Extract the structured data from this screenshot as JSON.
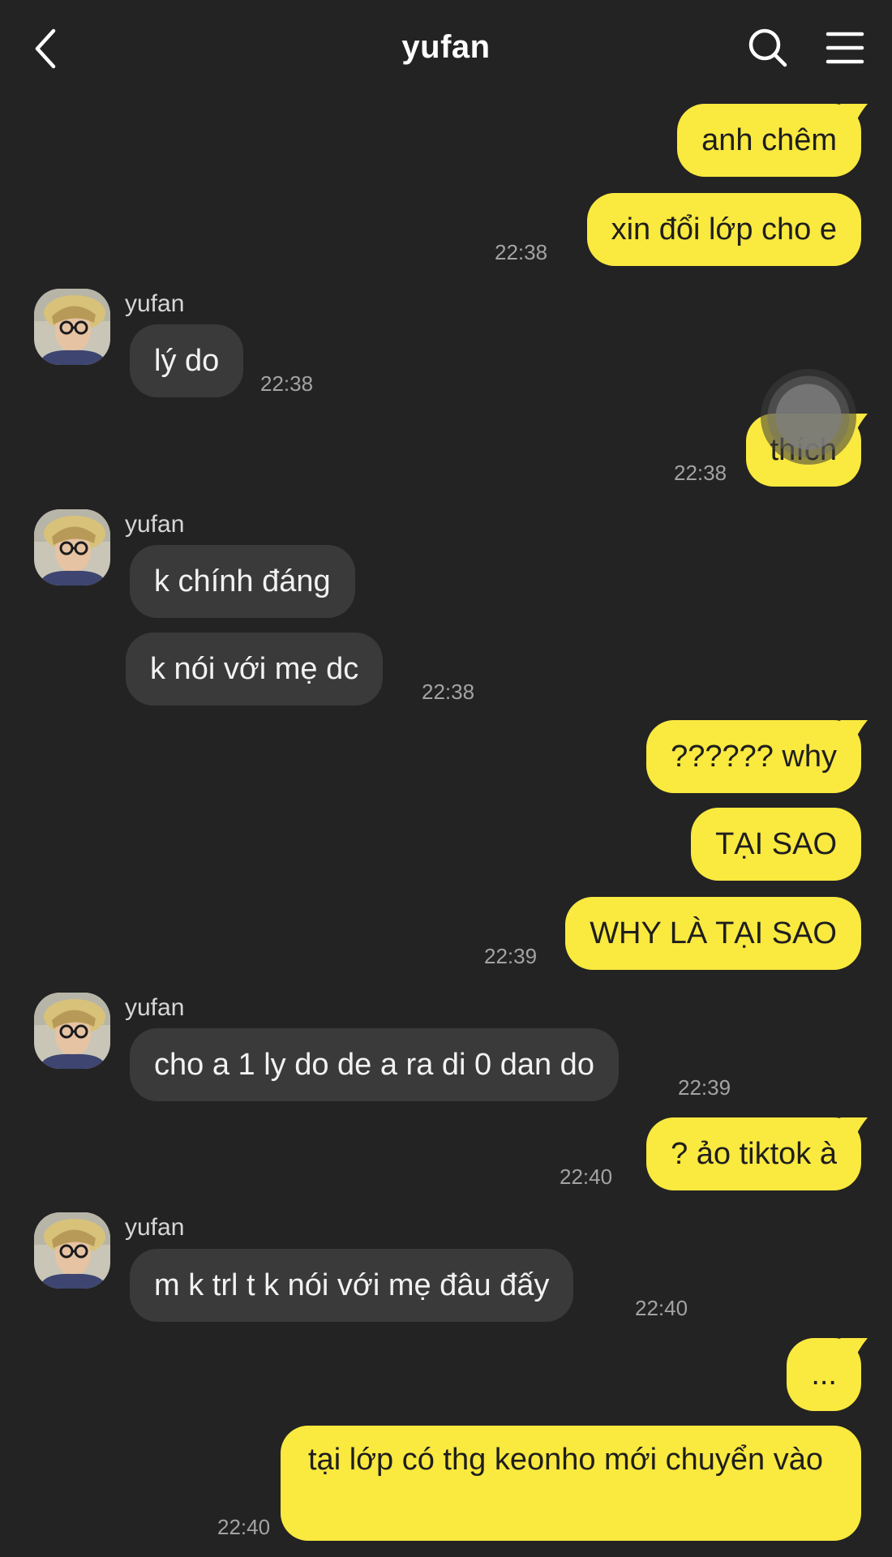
{
  "header": {
    "title": "yufan",
    "back_icon": "chevron-left-icon",
    "search_icon": "search-icon",
    "menu_icon": "menu-icon"
  },
  "colors": {
    "background": "#232323",
    "outgoing_bubble": "#fae93f",
    "incoming_bubble": "#3a3a3a",
    "timestamp": "#a3a3a3"
  },
  "messages": {
    "m1": "anh chêm",
    "m2": "xin đổi lớp cho e",
    "m2_time": "22:38",
    "g1_sender": "yufan",
    "m3": "lý do",
    "m3_time": "22:38",
    "m4": "thích",
    "m4_time": "22:38",
    "g2_sender": "yufan",
    "m5": "k chính đáng",
    "m6": "k nói với mẹ dc",
    "m6_time": "22:38",
    "m7": "?????? why",
    "m8": "TẠI SAO",
    "m9": "WHY LÀ TẠI SAO",
    "m9_time": "22:39",
    "g3_sender": "yufan",
    "m10": "cho a 1 ly do de a ra di 0 dan do",
    "m10_time": "22:39",
    "m11": "? ảo tiktok à",
    "m11_time": "22:40",
    "g4_sender": "yufan",
    "m12": "m k trl t k nói với mẹ đâu đấy",
    "m12_time": "22:40",
    "m13": "...",
    "m14": "tại lớp có thg keonho mới chuyển vào",
    "m14_time": "22:40"
  }
}
